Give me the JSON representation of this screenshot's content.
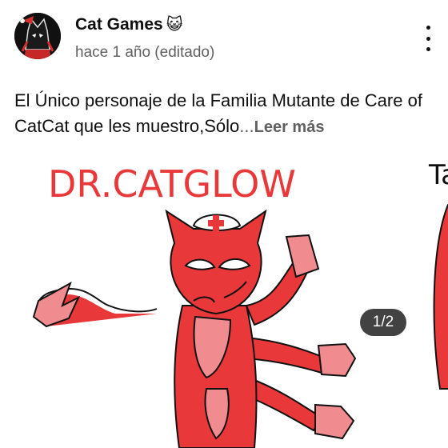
{
  "post": {
    "channel_name": "Cat Games",
    "channel_emoji": "😺",
    "time_ago": "hace 1 año (editado)",
    "text_preview": "El Único personaje de la Familia Mutante de Care of CatCat que les muestro,Sólo",
    "ellipsis": "...",
    "read_more_label": "Leer más",
    "menu_icon": "more-vert-icon"
  },
  "image": {
    "handwritten_title": "DR.CATGLOW",
    "next_slide_peek_text": "Ta",
    "counter": "1/2",
    "current_index": 1,
    "total": 2
  },
  "colors": {
    "text_primary": "#0f0f0f",
    "text_secondary": "#606060",
    "character_red": "#e8383a",
    "character_pink": "#f08b8f",
    "counter_bg": "#282828"
  }
}
